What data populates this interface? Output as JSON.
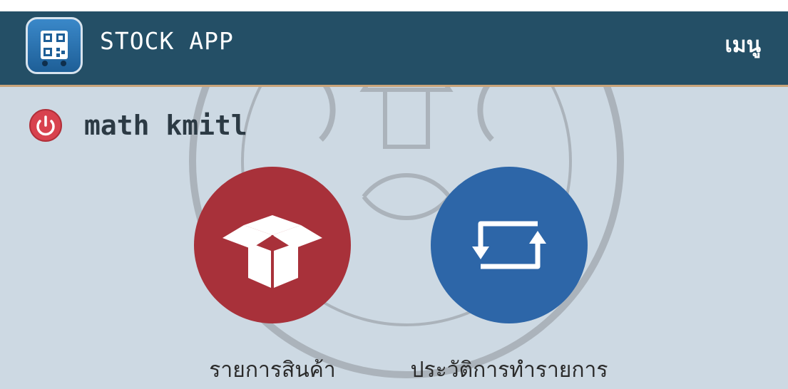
{
  "header": {
    "title": "STOCK APP",
    "menu_label": "เมนู",
    "app_icon": "qr-code-icon"
  },
  "user": {
    "name": "math kmitl",
    "logout_icon": "power-icon"
  },
  "tiles": [
    {
      "label": "รายการสินค้า",
      "icon": "box-icon",
      "color": "#a8313a"
    },
    {
      "label": "ประวัติการทำรายการ",
      "icon": "refresh-arrows-icon",
      "color": "#2d66a8"
    }
  ],
  "colors": {
    "header_bg": "#244f66",
    "content_bg": "#cdd9e3",
    "accent_red": "#a8313a",
    "accent_blue": "#2d66a8"
  }
}
